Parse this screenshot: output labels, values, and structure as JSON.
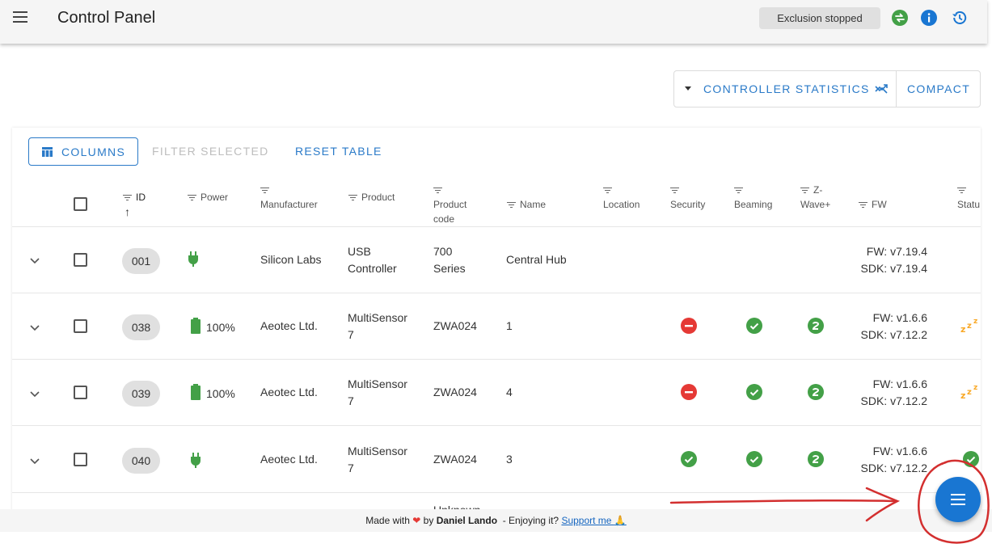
{
  "appbar": {
    "title": "Control Panel",
    "exclusion_status": "Exclusion stopped",
    "icons": [
      "sync-icon",
      "info-icon",
      "history-icon"
    ]
  },
  "toolbar": {
    "controller_statistics_label": "CONTROLLER STATISTICS",
    "compact_label": "COMPACT"
  },
  "table_actions": {
    "columns_label": "COLUMNS",
    "filter_selected_label": "FILTER SELECTED",
    "reset_table_label": "RESET TABLE"
  },
  "columns": {
    "id": "ID",
    "power": "Power",
    "manufacturer": "Manufacturer",
    "product": "Product",
    "product_code_line1": "Product",
    "product_code_line2": "code",
    "name": "Name",
    "location": "Location",
    "security": "Security",
    "beaming": "Beaming",
    "zwave_line1": "Z-",
    "zwave_line2": "Wave+",
    "fw": "FW",
    "status": "Statu"
  },
  "rows": [
    {
      "id": "001",
      "power": "plug",
      "power_text": "",
      "manufacturer": "Silicon Labs",
      "product_line1": "USB",
      "product_line2": "Controller",
      "code_line1": "700",
      "code_line2": "Series",
      "name": "Central Hub",
      "security": "",
      "beaming": "",
      "zwave": "",
      "fw": "FW: v7.19.4",
      "sdk": "SDK: v7.19.4",
      "status": ""
    },
    {
      "id": "038",
      "power": "battery",
      "power_text": "100%",
      "manufacturer": "Aeotec Ltd.",
      "product_line1": "MultiSensor",
      "product_line2": "7",
      "code_line1": "ZWA024",
      "code_line2": "",
      "name": "1",
      "security": "none",
      "beaming": "yes",
      "zwave": "2",
      "fw": "FW: v1.6.6",
      "sdk": "SDK: v7.12.2",
      "status": "asleep"
    },
    {
      "id": "039",
      "power": "battery",
      "power_text": "100%",
      "manufacturer": "Aeotec Ltd.",
      "product_line1": "MultiSensor",
      "product_line2": "7",
      "code_line1": "ZWA024",
      "code_line2": "",
      "name": "4",
      "security": "none",
      "beaming": "yes",
      "zwave": "2",
      "fw": "FW: v1.6.6",
      "sdk": "SDK: v7.12.2",
      "status": "asleep"
    },
    {
      "id": "040",
      "power": "plug",
      "power_text": "",
      "manufacturer": "Aeotec Ltd.",
      "product_line1": "MultiSensor",
      "product_line2": "7",
      "code_line1": "ZWA024",
      "code_line2": "",
      "name": "3",
      "security": "yes",
      "beaming": "yes",
      "zwave": "2",
      "fw": "FW: v1.6.6",
      "sdk": "SDK: v7.12.2",
      "status": "alive"
    }
  ],
  "partial_row": {
    "code_text": "Unknown"
  },
  "footer": {
    "made_with": "Made with",
    "by": "by",
    "author": "Daniel Lando",
    "enjoying": "- Enjoying it?",
    "support_link": "Support me"
  },
  "colors": {
    "primary": "#1976d2",
    "link": "#2a7ac8",
    "green": "#43a047",
    "red": "#e53935",
    "annotation": "#d32f2f"
  }
}
